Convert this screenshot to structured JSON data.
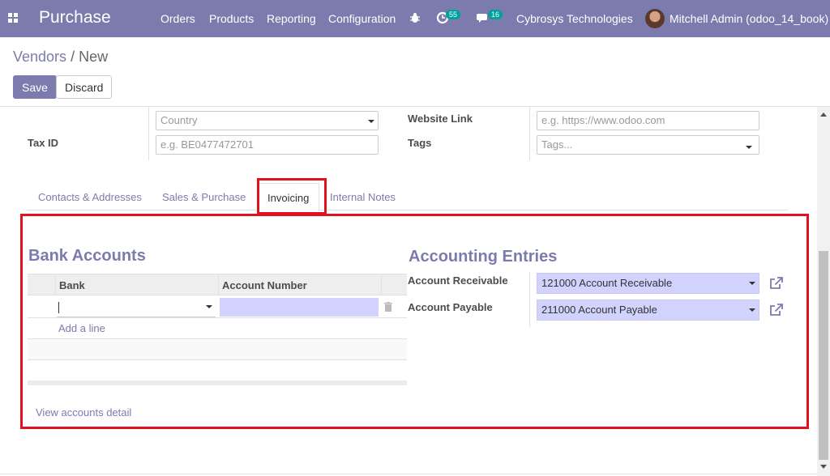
{
  "navbar": {
    "app_name": "Purchase",
    "menu": [
      "Orders",
      "Products",
      "Reporting",
      "Configuration"
    ],
    "activity_count": "55",
    "message_count": "16",
    "company": "Cybrosys Technologies",
    "user": "Mitchell Admin (odoo_14_book)",
    "background_color": "#7c7bad"
  },
  "breadcrumb": {
    "parent": "Vendors",
    "separator": " / ",
    "current": "New"
  },
  "actions": {
    "save_label": "Save",
    "discard_label": "Discard"
  },
  "form": {
    "country_placeholder": "Country",
    "tax_id_label": "Tax ID",
    "tax_id_placeholder": "e.g. BE0477472701",
    "website_label": "Website Link",
    "website_placeholder": "e.g. https://www.odoo.com",
    "tags_label": "Tags",
    "tags_placeholder": "Tags..."
  },
  "tabs": [
    {
      "label": "Contacts & Addresses",
      "active": false
    },
    {
      "label": "Sales & Purchase",
      "active": false
    },
    {
      "label": "Invoicing",
      "active": true
    },
    {
      "label": "Internal Notes",
      "active": false
    }
  ],
  "bank_accounts": {
    "title": "Bank Accounts",
    "columns": [
      "Bank",
      "Account Number"
    ],
    "add_line": "Add a line",
    "view_detail": "View accounts detail"
  },
  "accounting_entries": {
    "title": "Accounting Entries",
    "receivable_label": "Account Receivable",
    "receivable_value": "121000 Account Receivable",
    "payable_label": "Account Payable",
    "payable_value": "211000 Account Payable"
  },
  "colors": {
    "highlight": "#e0121e",
    "link": "#7c7bad",
    "required_field": "#d2d2ff"
  }
}
